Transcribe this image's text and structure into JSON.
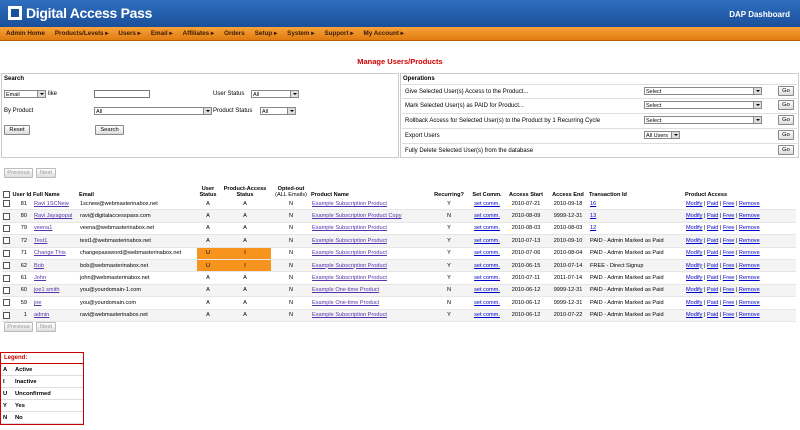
{
  "header": {
    "logo_text": "Digital Access Pass",
    "dashboard": "DAP Dashboard"
  },
  "menu": [
    "Admin Home",
    "Products/Levels ▸",
    "Users ▸",
    "Email ▸",
    "Affiliates ▸",
    "Orders",
    "Setup ▸",
    "System ▸",
    "Support ▸",
    "My Account ▸"
  ],
  "page_title": "Manage Users/Products",
  "search": {
    "title": "Search",
    "field_select": "Email",
    "like_label": "like",
    "user_status_label": "User Status",
    "user_status_value": "All",
    "by_product_label": "By Product",
    "by_product_value": "All",
    "product_status_label": "Product Status",
    "product_status_value": "All",
    "reset_label": "Reset",
    "search_label": "Search"
  },
  "operations": {
    "title": "Operations",
    "rows": [
      {
        "label": "Give Selected User(s) Access to the Product...",
        "select": "Select",
        "go": "Go"
      },
      {
        "label": "Mark Selected User(s) as PAID for Product...",
        "select": "Select",
        "go": "Go"
      },
      {
        "label": "Rollback Access for Selected User(s) to the Product by 1 Recurring Cycle",
        "select": "Select",
        "go": "Go"
      },
      {
        "label": "Export Users",
        "select": "All Users",
        "go": "Go"
      },
      {
        "label": "Fully Delete Selected User(s) from the database",
        "select": "",
        "go": "Go"
      }
    ]
  },
  "pager": {
    "previous": "Previous",
    "next": "Next"
  },
  "table": {
    "headers": [
      "User Id",
      "Full Name",
      "Email",
      "User Status",
      "Product-Access Status",
      "Opted-out",
      "(ALL Emails)",
      "Product Name",
      "Recurring?",
      "Set Comm.",
      "Access Start",
      "Access End",
      "Transaction Id",
      "Product Access"
    ],
    "rows": [
      {
        "id": "81",
        "name": "Ravi 1SCNew",
        "email": "1scnew@webmasterinabox.net",
        "us": "A",
        "ps": "A",
        "opt": "N",
        "product": "Example Subscription Product",
        "rec": "Y",
        "comm": "set comm.",
        "start": "2010-07-21",
        "end": "2010-09-18",
        "txn": "16",
        "txn_link": true,
        "hl": false
      },
      {
        "id": "80",
        "name": "Ravi Jayagopal",
        "email": "ravi@digitalaccesspass.com",
        "us": "A",
        "ps": "A",
        "opt": "N",
        "product": "Example Subscription Product Copy",
        "rec": "N",
        "comm": "set comm.",
        "start": "2010-08-09",
        "end": "9999-12-31",
        "txn": "13",
        "txn_link": true,
        "hl": false
      },
      {
        "id": "79",
        "name": "veena1",
        "email": "veena@webmasterinabox.net",
        "us": "A",
        "ps": "A",
        "opt": "N",
        "product": "Example Subscription Product",
        "rec": "Y",
        "comm": "set comm.",
        "start": "2010-08-03",
        "end": "2010-08-03",
        "txn": "12",
        "txn_link": true,
        "hl": false
      },
      {
        "id": "72",
        "name": "Test1",
        "email": "test1@webmasterinabox.net",
        "us": "A",
        "ps": "A",
        "opt": "N",
        "product": "Example Subscription Product",
        "rec": "Y",
        "comm": "set comm.",
        "start": "2010-07-13",
        "end": "2010-09-10",
        "txn": "PAID - Admin Marked as Paid",
        "txn_link": false,
        "hl": false
      },
      {
        "id": "71",
        "name": "Change This",
        "email": "changepassword@webmasterinabox.net",
        "us": "U",
        "ps": "I",
        "opt": "N",
        "product": "Example Subscription Product",
        "rec": "Y",
        "comm": "set comm.",
        "start": "2010-07-06",
        "end": "2010-08-04",
        "txn": "PAID - Admin Marked as Paid",
        "txn_link": false,
        "hl": true
      },
      {
        "id": "62",
        "name": "Bob",
        "email": "bob@webmasterinabox.net",
        "us": "U",
        "ps": "I",
        "opt": "N",
        "product": "Example Subscription Product",
        "rec": "Y",
        "comm": "set comm.",
        "start": "2010-06-15",
        "end": "2010-07-14",
        "txn": "FREE - Direct Signup",
        "txn_link": false,
        "hl": true
      },
      {
        "id": "61",
        "name": "John",
        "email": "john@webmasterinabox.net",
        "us": "A",
        "ps": "A",
        "opt": "N",
        "product": "Example Subscription Product",
        "rec": "Y",
        "comm": "set comm.",
        "start": "2010-07-11",
        "end": "2011-07-14",
        "txn": "PAID - Admin Marked as Paid",
        "txn_link": false,
        "hl": false
      },
      {
        "id": "60",
        "name": "joe1 smith",
        "email": "you@yourdomain-1.com",
        "us": "A",
        "ps": "A",
        "opt": "N",
        "product": "Example One-time Product",
        "rec": "N",
        "comm": "set comm.",
        "start": "2010-06-12",
        "end": "9999-12-31",
        "txn": "PAID - Admin Marked as Paid",
        "txn_link": false,
        "hl": false
      },
      {
        "id": "59",
        "name": "joe",
        "email": "you@yourdomain.com",
        "us": "A",
        "ps": "A",
        "opt": "N",
        "product": "Example One-time Product",
        "rec": "N",
        "comm": "set comm.",
        "start": "2010-06-12",
        "end": "9999-12-31",
        "txn": "PAID - Admin Marked as Paid",
        "txn_link": false,
        "hl": false
      },
      {
        "id": "1",
        "name": "admin",
        "email": "ravi@webmasterinabox.net",
        "us": "A",
        "ps": "A",
        "opt": "N",
        "product": "Example Subscription Product",
        "rec": "Y",
        "comm": "set comm.",
        "start": "2010-06-12",
        "end": "2010-07-22",
        "txn": "PAID - Admin Marked as Paid",
        "txn_link": false,
        "hl": false
      }
    ],
    "actions": [
      "Modify",
      "Paid",
      "Free",
      "Remove"
    ]
  },
  "legend": {
    "title": "Legend:",
    "items": [
      {
        "code": "A",
        "label": "Active"
      },
      {
        "code": "I",
        "label": "Inactive"
      },
      {
        "code": "U",
        "label": "Unconfirmed"
      },
      {
        "code": "Y",
        "label": "Yes"
      },
      {
        "code": "N",
        "label": "No"
      }
    ]
  },
  "colors": {
    "header_blue": "#1a4f9a",
    "menu_orange": "#f7941d",
    "title_red": "#cc0000",
    "link": "#5533aa"
  }
}
